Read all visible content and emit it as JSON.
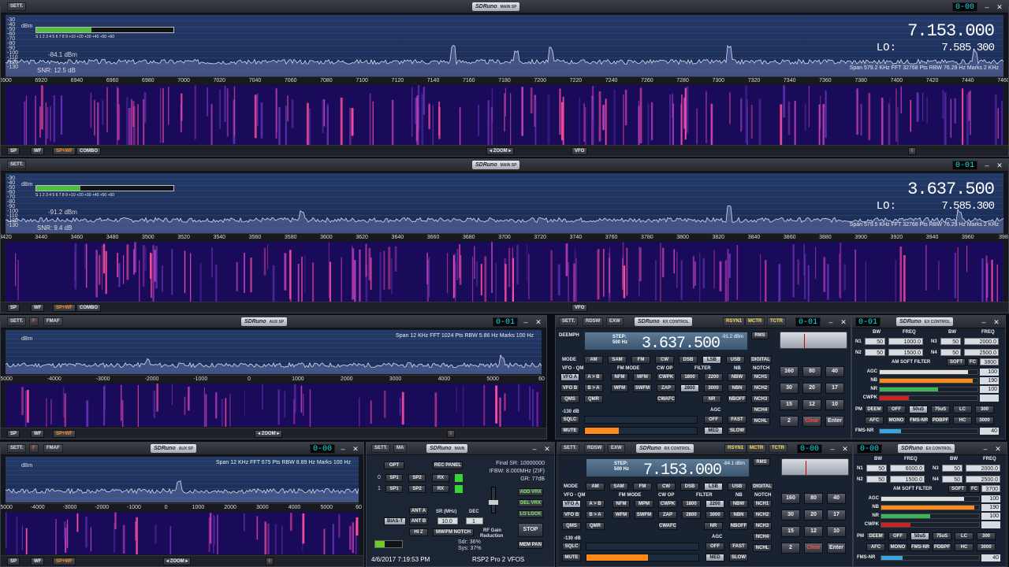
{
  "sp1": {
    "sett": "SETT.",
    "logo": "SDRuno",
    "sub": "MAIN SP",
    "vfo": "0-00",
    "freq": "7.153.000",
    "lo_label": "LO:",
    "lo": "7.585.300",
    "dbm": [
      "-30",
      "-40",
      "-50",
      "-60",
      "-70",
      "-80",
      "-90",
      "-100",
      "-110",
      "-120",
      "-130"
    ],
    "dbm_label": "dBm",
    "sig": "-84.1 dBm",
    "snr": "SNR: 12.5 dB",
    "info": "Span 579.2 KHz   FFT 32768 Pts   RBW 76.29 Hz   Marks 2 KHz",
    "scale": "S   1   2   3   4   5   6   7   8   9   +10  +20  +30  +40  +50  +60",
    "meter_fraction": 0.4,
    "axis": [
      "6900",
      "6920",
      "6940",
      "6960",
      "6980",
      "7000",
      "7020",
      "7040",
      "7060",
      "7080",
      "7100",
      "7120",
      "7140",
      "7160",
      "7180",
      "7200",
      "7220",
      "7240",
      "7260",
      "7280",
      "7300",
      "7320",
      "7340",
      "7360",
      "7380",
      "7400",
      "7420",
      "7440",
      "7460"
    ],
    "buttons": [
      "SP",
      "WF",
      "SP+WF",
      "COMBO"
    ],
    "zoom": "ZOOM",
    "vfo_btn": "VFO",
    "i": "i"
  },
  "sp2": {
    "sett": "SETT.",
    "logo": "SDRuno",
    "sub": "MAIN SP",
    "vfo": "0-01",
    "freq": "3.637.500",
    "lo_label": "LO:",
    "lo": "7.585.300",
    "dbm": [
      "-30",
      "-40",
      "-50",
      "-60",
      "-70",
      "-80",
      "-90",
      "-100",
      "-110",
      "-120",
      "-130"
    ],
    "dbm_label": "dBm",
    "sig": "-91.2 dBm",
    "snr": "SNR: 9.4 dB",
    "info": "Span 579.5 KHz   FFT 32768 Pts   RBW 76.29 Hz   Marks 2 KHz",
    "scale": "S   1   2   3   4   5   6   7   8   9   +10  +20  +30  +40  +50  +60",
    "meter_fraction": 0.32,
    "axis": [
      "3420",
      "3440",
      "3460",
      "3480",
      "3500",
      "3520",
      "3540",
      "3560",
      "3580",
      "3600",
      "3620",
      "3640",
      "3660",
      "3680",
      "3700",
      "3720",
      "3740",
      "3760",
      "3780",
      "3800",
      "3820",
      "3840",
      "3860",
      "3880",
      "3900",
      "3920",
      "3940",
      "3960",
      "398"
    ],
    "buttons": [
      "SP",
      "WF",
      "SP+WF",
      "COMBO"
    ],
    "vfo_btn": "VFO"
  },
  "aux1": {
    "sett": "SETT.",
    "f": "F",
    "fmaf": "FMAF",
    "logo": "SDRuno",
    "sub": "AUX SP",
    "vfo": "0-01",
    "info": "Span 12 KHz   FFT 1024 Pts   RBW 5.86 Hz   Marks 100 Hz",
    "dbm_label": "dBm",
    "axis": [
      "-5000",
      "-4000",
      "-3000",
      "-2000",
      "-1000",
      "0",
      "1000",
      "2000",
      "3000",
      "4000",
      "5000",
      "60"
    ],
    "buttons": [
      "SP",
      "WF",
      "SP+WF"
    ],
    "zoom": "ZOOM",
    "i": "i"
  },
  "aux2": {
    "sett": "SETT.",
    "f": "F",
    "fmaf": "FMAF",
    "logo": "SDRuno",
    "sub": "AUX SP",
    "vfo": "0-00",
    "info": "Span 12 KHz   FFT 675 Pts   RBW 8.89 Hz   Marks 100 Hz",
    "dbm_label": "dBm",
    "axis": [
      "-5000",
      "-4000",
      "-3000",
      "-2000",
      "-1000",
      "0",
      "1000",
      "2000",
      "3000",
      "4000",
      "5000",
      "60"
    ],
    "buttons": [
      "SP",
      "WF",
      "SP+WF"
    ],
    "zoom": "ZOOM",
    "i": "i"
  },
  "rx1": {
    "top": [
      "SETT.",
      "RDSW",
      "EXW"
    ],
    "logo": "SDRuno",
    "sub": "RX CONTROL",
    "top2": [
      "RSYN1",
      "MCTR",
      "TCTR"
    ],
    "vfo": "0-01",
    "deemph": "DEEMPH",
    "step": "STEP:",
    "step_val": "500 Hz",
    "freq": "3.637.500",
    "dbm": "-91.2 dBm",
    "rms": "RMS",
    "mode": "MODE",
    "modes": [
      "AM",
      "SAM",
      "FM",
      "CW",
      "DSB",
      "LSB",
      "USB",
      "DIGITAL"
    ],
    "active_mode": "LSB",
    "vfo_qm": "VFO - QM",
    "vfo_btns": [
      "VFO A",
      "VFO B",
      "QMS"
    ],
    "ab": [
      "A > B",
      "B > A",
      "QMR"
    ],
    "fm_mode": "FM MODE",
    "fm": [
      "NFM",
      "WFM"
    ],
    "fm2": [
      "MFM",
      "SWFM"
    ],
    "cw_op": "CW OP",
    "cw": [
      "CWPK",
      "ZAP",
      "CWAFC"
    ],
    "filter": "FILTER",
    "filters": [
      "1800",
      "2200",
      "2800",
      "3000",
      "NR"
    ],
    "active_filter": "2800",
    "nb": "NB",
    "nbs": [
      "NBW",
      "NBN",
      "NBOFF"
    ],
    "notch": "NOTCH",
    "notches": [
      "NCH1",
      "NCH2",
      "NCH3",
      "NCH4",
      "NCHL"
    ],
    "db130": "-130 dB",
    "sqlc": "SQLC",
    "mute": "MUTE",
    "agc": "AGC",
    "agcs": [
      "OFF",
      "FAST",
      "MED",
      "SLOW"
    ],
    "pads": [
      "160",
      "80",
      "40",
      "30",
      "20",
      "17",
      "15",
      "12",
      "10",
      "2",
      "Clear",
      "Enter"
    ],
    "vol": 0.3
  },
  "rx2": {
    "top": [
      "SETT.",
      "RDSW",
      "EXW"
    ],
    "logo": "SDRuno",
    "sub": "RX CONTROL",
    "top2": [
      "RSYN1",
      "MCTR",
      "TCTR"
    ],
    "vfo": "0-00",
    "step": "STEP:",
    "step_val": "500 Hz",
    "freq": "7.153.000",
    "dbm": "-84.1 dBm",
    "rms": "RMS",
    "mode": "MODE",
    "modes": [
      "AM",
      "SAM",
      "FM",
      "CW",
      "DSB",
      "LSB",
      "USB",
      "DIGITAL"
    ],
    "active_mode": "LSB",
    "vfo_qm": "VFO - QM",
    "vfo_btns": [
      "VFO A",
      "VFO B",
      "QMS"
    ],
    "ab": [
      "A > B",
      "B > A",
      "QMR"
    ],
    "fm_mode": "FM MODE",
    "fm": [
      "NFM",
      "WFM"
    ],
    "fm2": [
      "MPM",
      "SWFM"
    ],
    "cw_op": "CW OP",
    "cw": [
      "CWPK",
      "ZAP",
      "CWAFC"
    ],
    "filter": "FILTER",
    "filters": [
      "1800",
      "2200",
      "2800",
      "3000",
      "NR"
    ],
    "active_filter": "2200",
    "nb": "NB",
    "nbs": [
      "NBW",
      "NBN",
      "NBOFF"
    ],
    "notch": "NOTCH",
    "notches": [
      "NCH1",
      "NCH2",
      "NCH3",
      "NCH4",
      "NCHL"
    ],
    "db130": "-130 dB",
    "sqlc": "SQLC",
    "mute": "MUTE",
    "agc": "AGC",
    "agcs": [
      "OFF",
      "FAST",
      "MED",
      "SLOW"
    ],
    "pads": [
      "160",
      "80",
      "40",
      "30",
      "20",
      "17",
      "15",
      "12",
      "10",
      "2",
      "Clear",
      "Enter"
    ],
    "vol": 0.55
  },
  "ex1": {
    "vfo": "0-01",
    "logo": "SDRuno",
    "sub": "EX CONTROL",
    "bw": "BW",
    "freq": "FREQ",
    "n1": "N1",
    "n2": "N2",
    "n3": "N3",
    "n4": "N4",
    "n1bw": "50",
    "n1f": "1000.0",
    "n2bw": "50",
    "n2f": "1500.0",
    "n3bw": "50",
    "n3f": "2000.0",
    "n4bw": "50",
    "n4f": "2500.0",
    "amsoft": "AM SOFT FILTER",
    "soft": "SOFT",
    "fc": "FC",
    "fcv": "3800",
    "rows": [
      {
        "l": "AGC",
        "v": "100",
        "c": "#e0e0e0",
        "p": 0.9
      },
      {
        "l": "NB",
        "v": "190",
        "c": "#ff8a1c",
        "p": 0.95
      },
      {
        "l": "NR",
        "v": "100",
        "c": "#3fb55a",
        "p": 0.6
      },
      {
        "l": "CWPK",
        "v": "",
        "c": "#d02020",
        "p": 0.3
      }
    ],
    "pm": "PM",
    "pm_btns": [
      "DEEM",
      "OFF",
      "50uS",
      "75uS",
      "LC",
      "300"
    ],
    "pm_btns2": [
      "AFC",
      "MONO",
      "FMS-NR",
      "PDBPF",
      "HC",
      "3000"
    ],
    "fms": "FMS-NR",
    "fmsv": "40"
  },
  "ex2": {
    "vfo": "0-00",
    "logo": "SDRuno",
    "sub": "EX CONTROL",
    "bw": "BW",
    "freq": "FREQ",
    "n1": "N1",
    "n2": "N2",
    "n3": "N3",
    "n4": "N4",
    "n1bw": "50",
    "n1f": "6000.0",
    "n2bw": "50",
    "n2f": "1500.0",
    "n3bw": "50",
    "n3f": "2000.0",
    "n4bw": "50",
    "n4f": "2500.0",
    "amsoft": "AM SOFT FILTER",
    "soft": "SOFT",
    "fc": "FC",
    "fcv": "3700",
    "rows": [
      {
        "l": "AGC",
        "v": "100",
        "c": "#e0e0e0",
        "p": 0.85
      },
      {
        "l": "NB",
        "v": "190",
        "c": "#ff8a1c",
        "p": 0.95
      },
      {
        "l": "NR",
        "v": "100",
        "c": "#3fb55a",
        "p": 0.5
      },
      {
        "l": "CWPK",
        "v": "",
        "c": "#d02020",
        "p": 0.3
      }
    ],
    "pm": "PM",
    "pm_btns": [
      "DEEM",
      "OFF",
      "50uS",
      "75uS",
      "LC",
      "300"
    ],
    "pm_btns2": [
      "AFC",
      "MONO",
      "FMS-NR",
      "PDBPF",
      "HC",
      "3000"
    ],
    "fms": "FMS-NR",
    "fmsv": "40"
  },
  "main": {
    "sett": "SETT.",
    "ma": "MA",
    "logo": "SDRuno",
    "sub": "MAIN",
    "opt": "OPT",
    "rec": "REC PANEL",
    "row0": "0",
    "row1": "1",
    "sp1": "SP1",
    "sp2": "SP2",
    "rx": "RX",
    "final_sr": "Final SR: 10000000",
    "ifbw": "IFBW: 8.000MHz (ZIF)",
    "gr": "GR: 77dB",
    "add_vrx": "ADD VRX",
    "del_vrx": "DEL VRX",
    "lo_lock": "LO LOCK",
    "stop": "STOP",
    "mem": "MEM PAN",
    "ant_a": "ANT A",
    "ant_b": "ANT B",
    "hiz": "HI Z",
    "bias": "BIAS-T",
    "mw": "MW/FM NOTCH",
    "sr_lbl": "SR (MHz)",
    "sr": "10.0",
    "dec_lbl": "DEC",
    "dec": "1",
    "rfgain": "RF Gain",
    "reduction": "Reduction",
    "sdr": "Sdr: 36%",
    "sys": "Sys: 37%",
    "datetime": "4/6/2017 7:19:53 PM",
    "device": "RSP2 Pro 2 VFOS"
  }
}
